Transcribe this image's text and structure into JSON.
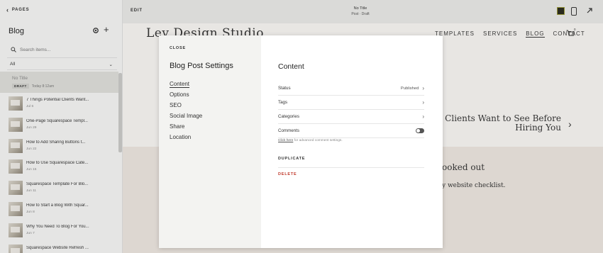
{
  "sidebar": {
    "pages_label": "PAGES",
    "title": "Blog",
    "search_placeholder": "Search items...",
    "filter_label": "All",
    "selected_post": {
      "title": "No Title",
      "badge": "DRAFT",
      "date": "Today 8:12am"
    },
    "posts": [
      {
        "title": "7 Things Potential Clients Want...",
        "date": "Jul 6"
      },
      {
        "title": "One-Page Squarespace Templ...",
        "date": "Jun 29"
      },
      {
        "title": "How to Add Sharing Buttons t...",
        "date": "Jun 22"
      },
      {
        "title": "How to Use Squarespace Cate...",
        "date": "Jun 15"
      },
      {
        "title": "Squarespace Template For Blo...",
        "date": "Jun 11"
      },
      {
        "title": "How to Start a Blog With Squar...",
        "date": "Jun 8"
      },
      {
        "title": "Why You Need To Blog For You...",
        "date": "Jun 7"
      },
      {
        "title": "Squarespace Website Refresh ...",
        "date": ""
      }
    ]
  },
  "topbar": {
    "edit_label": "EDIT",
    "doc_title": "No Title",
    "doc_status": "Post · Draft"
  },
  "site": {
    "logo": "Lev Design Studio",
    "nav": [
      "TEMPLATES",
      "SERVICES",
      "BLOG",
      "CONTACT"
    ],
    "cart_count": "0",
    "hero_title": "Clients Want to See Before Hiring You",
    "band_line1": "ooked out",
    "band_line2": "y website checklist."
  },
  "modal": {
    "close_label": "CLOSE",
    "heading": "Blog Post Settings",
    "nav": [
      "Content",
      "Options",
      "SEO",
      "Social Image",
      "Share",
      "Location"
    ],
    "content_heading": "Content",
    "status_label": "Status",
    "status_value": "Published",
    "tags_label": "Tags",
    "categories_label": "Categories",
    "comments_label": "Comments",
    "hint_link": "Click here",
    "hint_text": " for advanced comment settings.",
    "duplicate_label": "DUPLICATE",
    "delete_label": "DELETE"
  },
  "colors": {
    "delete": "#c0392b",
    "overlay_panel": "#f3f3f1"
  }
}
